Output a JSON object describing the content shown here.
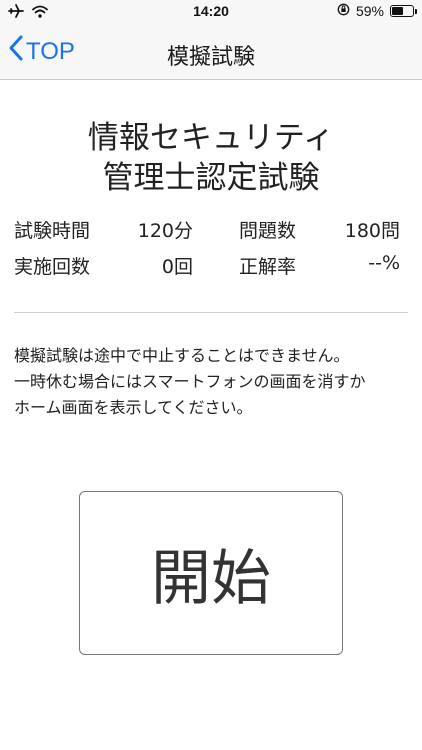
{
  "status_bar": {
    "time": "14:20",
    "battery_text": "59%",
    "battery_level": 0.59,
    "icons": [
      "airplane-icon",
      "wifi-icon",
      "orientation-lock-icon",
      "battery-icon"
    ]
  },
  "nav": {
    "back_label": "TOP",
    "title": "模擬試験"
  },
  "exam": {
    "title_line1": "情報セキュリティ",
    "title_line2": "管理士認定試験"
  },
  "stats": {
    "time_label": "試験時間",
    "time_value": "120分",
    "questions_label": "問題数",
    "questions_value": "180問",
    "attempts_label": "実施回数",
    "attempts_value": "0回",
    "accuracy_label": "正解率",
    "accuracy_value": "--%"
  },
  "notice": {
    "line1": "模擬試験は途中で中止することはできません。",
    "line2": "一時休む場合にはスマートフォンの画面を消すか",
    "line3": "ホーム画面を表示してください。"
  },
  "start_label": "開始",
  "colors": {
    "accent": "#1a73e8",
    "bar_background": "#f7f7f7"
  }
}
